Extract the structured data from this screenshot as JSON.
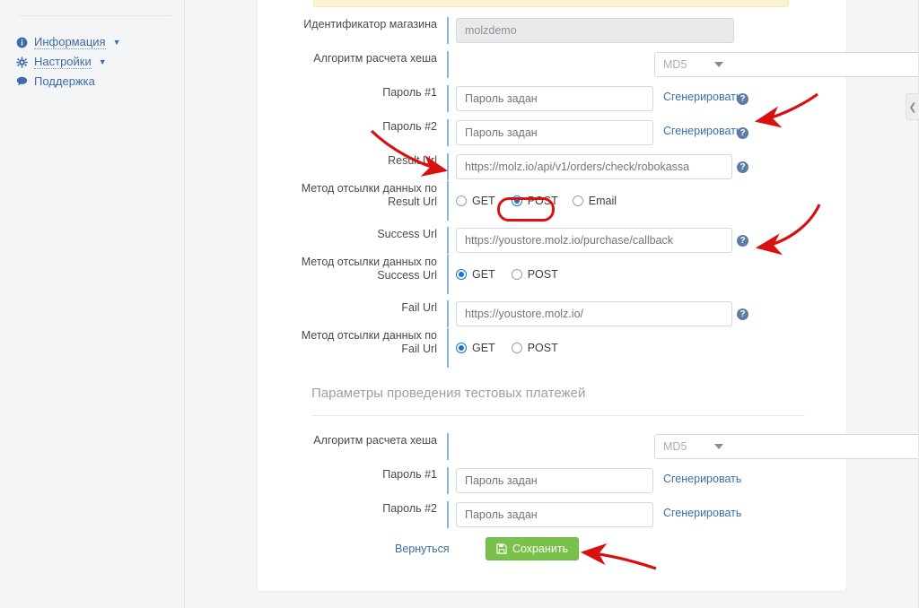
{
  "sidebar": {
    "items": [
      {
        "label": "Информация",
        "icon": "info-circle-icon",
        "caret": "▼"
      },
      {
        "label": "Настройки",
        "icon": "gear-icon",
        "caret": "▼"
      },
      {
        "label": "Поддержка",
        "icon": "chat-bubble-icon",
        "caret": ""
      }
    ]
  },
  "form": {
    "shop_id": {
      "label": "Идентификатор магазина",
      "value": "molzdemo"
    },
    "hash_algo_main": {
      "label": "Алгоритм расчета хеша",
      "value": "MD5"
    },
    "password1": {
      "label": "Пароль #1",
      "placeholder": "Пароль задан",
      "generate": "Сгенерировать"
    },
    "password2": {
      "label": "Пароль #2",
      "placeholder": "Пароль задан",
      "generate": "Сгенерировать"
    },
    "result_url": {
      "label": "Result Url",
      "placeholder": "https://molz.io/api/v1/orders/check/robokassa"
    },
    "result_method": {
      "label": "Метод отсылки данных по Result Url",
      "label_line1": "Метод отсылки данных по",
      "label_line2": "Result Url",
      "options": [
        "GET",
        "POST",
        "Email"
      ],
      "selected": "POST"
    },
    "success_url": {
      "label": "Success Url",
      "placeholder": "https://youstore.molz.io/purchase/callback"
    },
    "success_method": {
      "label_line1": "Метод отсылки данных по",
      "label_line2": "Success Url",
      "options": [
        "GET",
        "POST"
      ],
      "selected": "GET"
    },
    "fail_url": {
      "label": "Fail Url",
      "placeholder": "https://youstore.molz.io/"
    },
    "fail_method": {
      "label_line1": "Метод отсылки данных по",
      "label_line2": "Fail Url",
      "options": [
        "GET",
        "POST"
      ],
      "selected": "GET"
    },
    "test_section": {
      "heading": "Параметры проведения тестовых платежей",
      "hash_algo": {
        "label": "Алгоритм расчета хеша",
        "value": "MD5"
      },
      "password1": {
        "label": "Пароль #1",
        "placeholder": "Пароль задан",
        "generate": "Сгенерировать"
      },
      "password2": {
        "label": "Пароль #2",
        "placeholder": "Пароль задан",
        "generate": "Сгенерировать"
      }
    },
    "footer": {
      "back": "Вернуться",
      "save": "Сохранить",
      "save_icon": "floppy-disk-icon"
    },
    "help_icon_char": "?"
  },
  "right_panel": {
    "toggle_icon": "chevron-left-icon",
    "toggle_char": "❮"
  },
  "colors": {
    "accent_link": "#3c6ca8",
    "save_green": "#79c14a",
    "radio_blue": "#1a73c8",
    "annotation_red": "#e01010",
    "alert_yellow": "#fcf3d3",
    "page_bg": "#f4f5f7",
    "help_badge": "#5b7da5"
  }
}
